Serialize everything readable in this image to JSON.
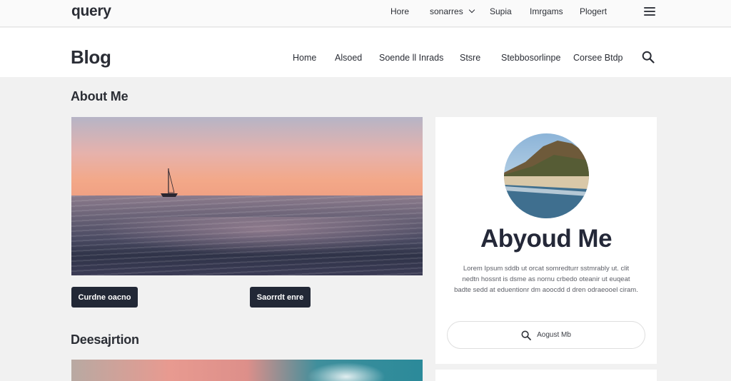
{
  "topbar": {
    "logo": "query",
    "nav": [
      {
        "label": "Hore"
      },
      {
        "label": "sonarres",
        "has_dropdown": true
      },
      {
        "label": "Supia"
      },
      {
        "label": "Imrgams"
      },
      {
        "label": "Plogert"
      }
    ],
    "menu_icon": "hamburger-icon"
  },
  "blog_header": {
    "title": "Blog",
    "nav": [
      {
        "label": "Home"
      },
      {
        "label": "Alsoed"
      },
      {
        "label": "Soende ll Inrads"
      },
      {
        "label": "Stsre"
      },
      {
        "label": "Stebbosorlinpe"
      },
      {
        "label": "Corsee Btdp"
      }
    ],
    "search_icon": "search-icon"
  },
  "main": {
    "about_heading": "About Me",
    "buttons": [
      {
        "label": "Curdne oacno"
      },
      {
        "label": "Saorrdt enre"
      }
    ],
    "description_heading": "Deesajrtion"
  },
  "sidebar": {
    "title": "Abyoud Me",
    "text": "Lorem Ipsum sddb ut orcat somredturr sstmrably ut. clit  nedtn hossnt is dsme as nornu crbedo oteanir ut euqeat badte sedd at eduentionr dm aoocdd d dren odraeooel ciram.",
    "search_label": "Aogust Mb",
    "search_icon": "search-icon"
  },
  "colors": {
    "button_bg": "#222836",
    "text_dark": "#23262f",
    "page_bg": "#f1f1f1"
  }
}
